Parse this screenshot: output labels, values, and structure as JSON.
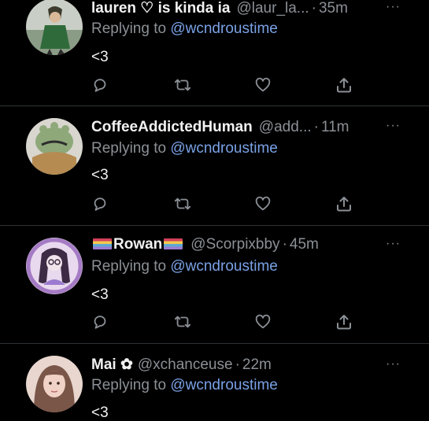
{
  "tweets": [
    {
      "display_name": "lauren ♡ is kinda ia",
      "handle": "@laur_la...",
      "separator": "·",
      "time": "35m",
      "replying_prefix": "Replying to ",
      "replying_to": "@wcndroustime",
      "text": "<3",
      "avatar": "lauren-avatar"
    },
    {
      "display_name": "CoffeeAddictedHuman",
      "handle": "@add...",
      "separator": "·",
      "time": "11m",
      "replying_prefix": "Replying to ",
      "replying_to": "@wcndroustime",
      "text": "<3",
      "avatar": "coffee-avatar"
    },
    {
      "display_name": "Rowan",
      "handle": "@Scorpixbby",
      "separator": "·",
      "time": "45m",
      "replying_prefix": "Replying to ",
      "replying_to": "@wcndroustime",
      "text": "<3",
      "avatar": "rowan-avatar",
      "name_decoration": "pride-flag"
    },
    {
      "display_name": "Mai ✿",
      "handle": "@xchanceuse",
      "separator": "·",
      "time": "22m",
      "replying_prefix": "Replying to ",
      "replying_to": "@wcndroustime",
      "text": "<3",
      "avatar": "mai-avatar"
    }
  ],
  "more_label": "···",
  "icons": [
    "reply-icon",
    "retweet-icon",
    "like-icon",
    "share-icon"
  ],
  "colors": {
    "background": "#000000",
    "text": "#f2f2f2",
    "muted": "#8b9096",
    "link": "#7aa2e6",
    "divider": "#2f3336"
  }
}
